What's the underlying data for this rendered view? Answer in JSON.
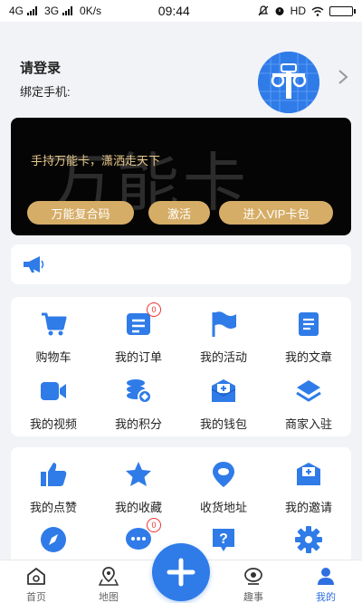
{
  "status_bar": {
    "network1": "4G",
    "network2": "3G",
    "speed": "0K/s",
    "time": "09:44",
    "hd": "HD"
  },
  "profile": {
    "login": "请登录",
    "phone_label": "绑定手机:"
  },
  "vip": {
    "watermark": "万能卡",
    "slogan": "手持万能卡，潇洒走天下",
    "buttons": [
      "万能复合码",
      "激活",
      "进入VIP卡包"
    ],
    "accent": "#d6ad67"
  },
  "grid1": [
    {
      "label": "购物车",
      "icon": "cart-icon"
    },
    {
      "label": "我的订单",
      "icon": "order-icon",
      "badge": "0"
    },
    {
      "label": "我的活动",
      "icon": "flag-icon"
    },
    {
      "label": "我的文章",
      "icon": "article-icon"
    },
    {
      "label": "我的视频",
      "icon": "video-icon"
    },
    {
      "label": "我的积分",
      "icon": "points-icon"
    },
    {
      "label": "我的钱包",
      "icon": "wallet-icon"
    },
    {
      "label": "商家入驻",
      "icon": "merchant-icon"
    }
  ],
  "grid2": [
    {
      "label": "我的点赞",
      "icon": "thumbs-up-icon"
    },
    {
      "label": "我的收藏",
      "icon": "star-icon"
    },
    {
      "label": "收货地址",
      "icon": "location-icon"
    },
    {
      "label": "我的邀请",
      "icon": "invite-mail-icon"
    },
    {
      "label": "",
      "icon": "compass-icon"
    },
    {
      "label": "",
      "icon": "message-icon",
      "badge": "0"
    },
    {
      "label": "",
      "icon": "help-icon"
    },
    {
      "label": "",
      "icon": "settings-gear-icon"
    }
  ],
  "tabbar": {
    "tabs": [
      {
        "label": "首页",
        "icon": "home-icon"
      },
      {
        "label": "地图",
        "icon": "map-icon"
      },
      {
        "label": "趣事",
        "icon": "eye-icon"
      },
      {
        "label": "我的",
        "icon": "person-icon"
      }
    ],
    "active": "我的"
  },
  "colors": {
    "primary": "#2f7be8",
    "background": "#f2f3f7",
    "badge": "#e33333"
  }
}
